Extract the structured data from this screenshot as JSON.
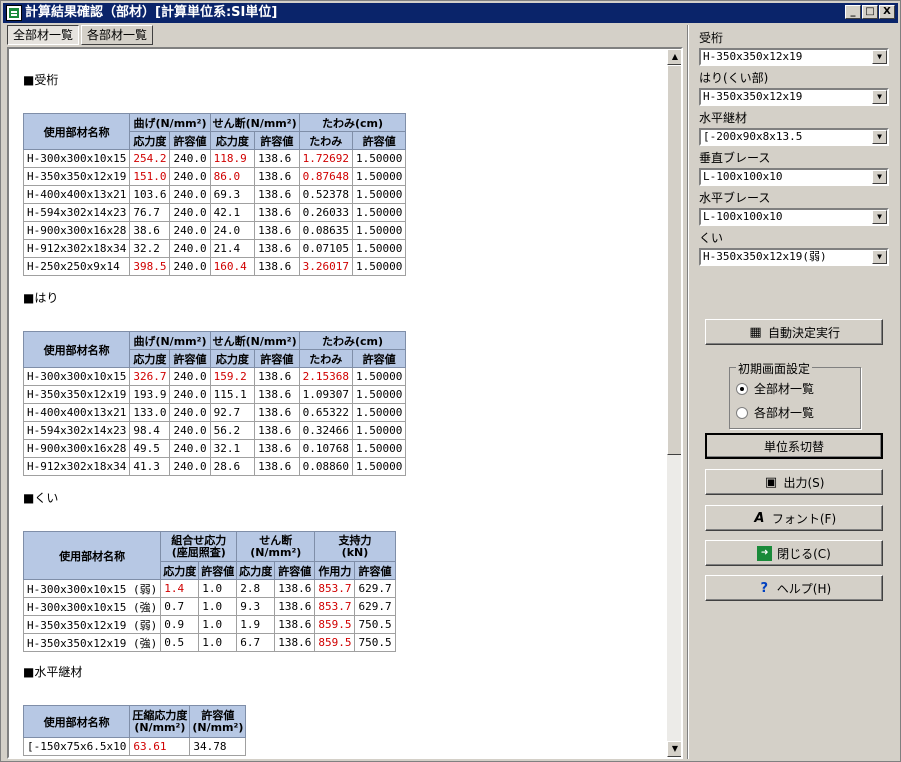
{
  "window": {
    "title": "計算結果確認（部材）[計算単位系:SI単位]",
    "min": "_",
    "max": "□",
    "close": "X"
  },
  "tabs": [
    "全部材一覧",
    "各部材一覧"
  ],
  "sections": {
    "ukegeta": {
      "title": "■受桁",
      "headers": [
        "使用部材名称",
        "曲げ(N/mm²)",
        "せん断(N/mm²)",
        "たわみ(cm)",
        "応力度",
        "許容値",
        "応力度",
        "許容値",
        "たわみ",
        "許容値"
      ],
      "rows": [
        [
          "H-300x300x10x15",
          "254.2",
          "240.0",
          "118.9",
          "138.6",
          "1.72692",
          "1.50000"
        ],
        [
          "H-350x350x12x19",
          "151.0",
          "240.0",
          "86.0",
          "138.6",
          "0.87648",
          "1.50000"
        ],
        [
          "H-400x400x13x21",
          "103.6",
          "240.0",
          "69.3",
          "138.6",
          "0.52378",
          "1.50000"
        ],
        [
          "H-594x302x14x23",
          "76.7",
          "240.0",
          "42.1",
          "138.6",
          "0.26033",
          "1.50000"
        ],
        [
          "H-900x300x16x28",
          "38.6",
          "240.0",
          "24.0",
          "138.6",
          "0.08635",
          "1.50000"
        ],
        [
          "H-912x302x18x34",
          "32.2",
          "240.0",
          "21.4",
          "138.6",
          "0.07105",
          "1.50000"
        ],
        [
          "H-250x250x9x14",
          "398.5",
          "240.0",
          "160.4",
          "138.6",
          "3.26017",
          "1.50000"
        ]
      ]
    },
    "hari": {
      "title": "■はり",
      "headers": [
        "使用部材名称",
        "曲げ(N/mm²)",
        "せん断(N/mm²)",
        "たわみ(cm)",
        "応力度",
        "許容値",
        "応力度",
        "許容値",
        "たわみ",
        "許容値"
      ],
      "rows": [
        [
          "H-300x300x10x15",
          "326.7",
          "240.0",
          "159.2",
          "138.6",
          "2.15368",
          "1.50000"
        ],
        [
          "H-350x350x12x19",
          "193.9",
          "240.0",
          "115.1",
          "138.6",
          "1.09307",
          "1.50000"
        ],
        [
          "H-400x400x13x21",
          "133.0",
          "240.0",
          "92.7",
          "138.6",
          "0.65322",
          "1.50000"
        ],
        [
          "H-594x302x14x23",
          "98.4",
          "240.0",
          "56.2",
          "138.6",
          "0.32466",
          "1.50000"
        ],
        [
          "H-900x300x16x28",
          "49.5",
          "240.0",
          "32.1",
          "138.6",
          "0.10768",
          "1.50000"
        ],
        [
          "H-912x302x18x34",
          "41.3",
          "240.0",
          "28.6",
          "138.6",
          "0.08860",
          "1.50000"
        ]
      ]
    },
    "kui": {
      "title": "■くい",
      "headers": [
        "使用部材名称",
        "組合せ応力\n(座屈照査)",
        "せん断\n(N/mm²)",
        "支持力\n(kN)",
        "応力度",
        "許容値",
        "応力度",
        "許容値",
        "作用力",
        "許容値"
      ],
      "rows": [
        [
          "H-300x300x10x15 (弱)",
          "1.4",
          "1.0",
          "2.8",
          "138.6",
          "853.7",
          "629.7"
        ],
        [
          "H-300x300x10x15 (強)",
          "0.7",
          "1.0",
          "9.3",
          "138.6",
          "853.7",
          "629.7"
        ],
        [
          "H-350x350x12x19 (弱)",
          "0.9",
          "1.0",
          "1.9",
          "138.6",
          "859.5",
          "750.5"
        ],
        [
          "H-350x350x12x19 (強)",
          "0.5",
          "1.0",
          "6.7",
          "138.6",
          "859.5",
          "750.5"
        ]
      ]
    },
    "suihei": {
      "title": "■水平継材",
      "headers": [
        "使用部材名称",
        "圧縮応力度\n(N/mm²)",
        "許容値\n(N/mm²)"
      ],
      "rows": [
        [
          "[-150x75x6.5x10",
          "63.61",
          "34.78"
        ]
      ]
    }
  },
  "right_panel": {
    "fields": [
      {
        "label": "受桁",
        "value": "H-350x350x12x19"
      },
      {
        "label": "はり(くい部)",
        "value": "H-350x350x12x19"
      },
      {
        "label": "水平継材",
        "value": "[-200x90x8x13.5"
      },
      {
        "label": "垂直ブレース",
        "value": "L-100x100x10"
      },
      {
        "label": "水平ブレース",
        "value": "L-100x100x10"
      },
      {
        "label": "くい",
        "value": "H-350x350x12x19(弱)"
      }
    ],
    "auto_button": "自動決定実行",
    "group_label": "初期画面設定",
    "radio_all": "全部材一覧",
    "radio_each": "各部材一覧",
    "unit_button": "単位系切替",
    "output_button": "出力(S)",
    "font_button": "フォント(F)",
    "close_button": "閉じる(C)",
    "help_button": "ヘルプ(H)"
  }
}
